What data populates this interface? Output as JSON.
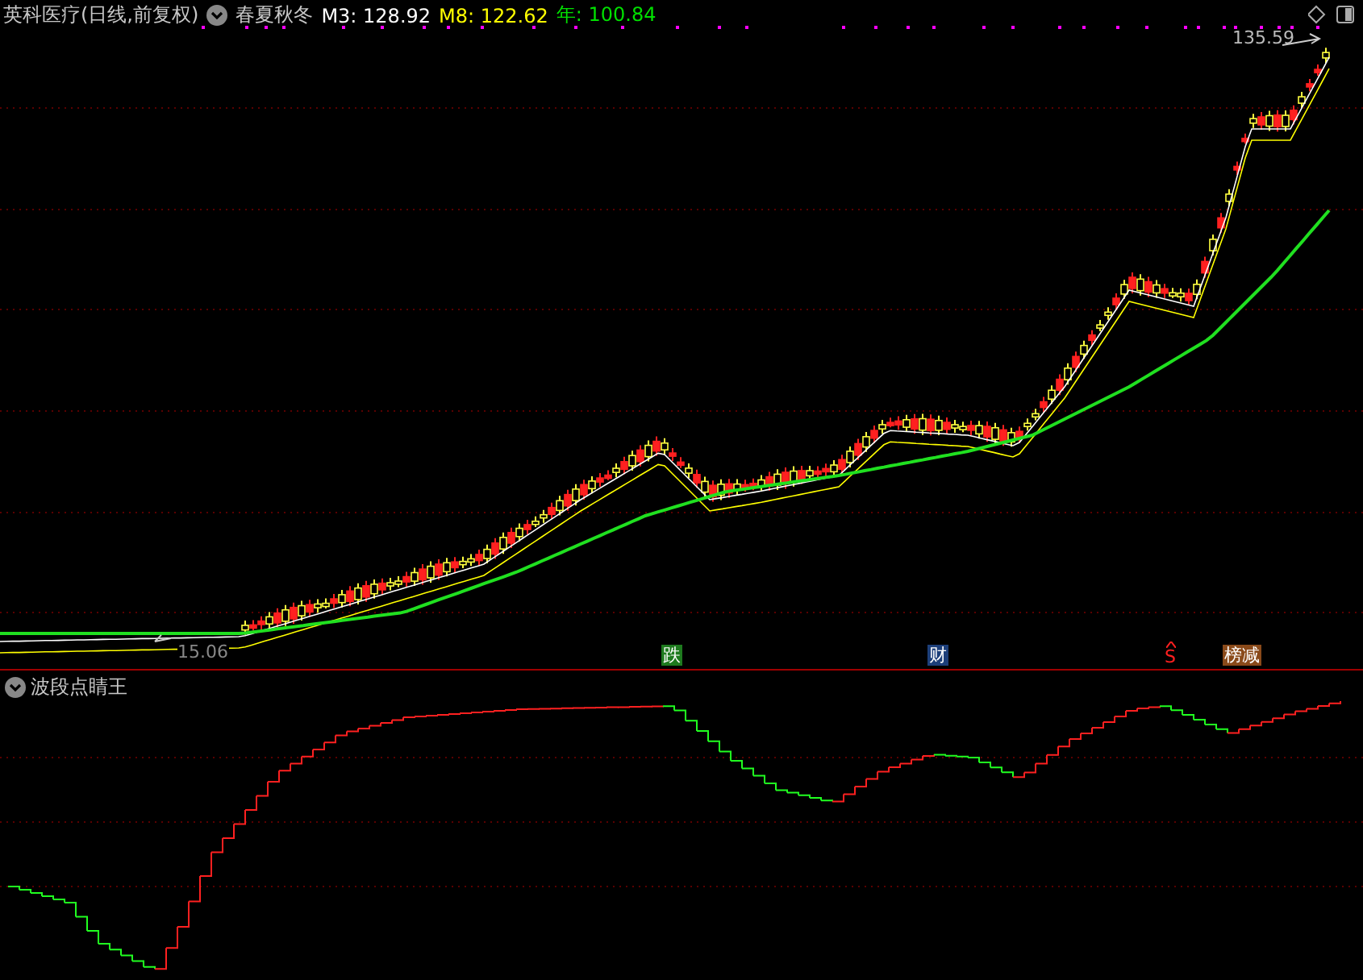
{
  "header": {
    "stock_title": "英科医疗(日线,前复权)",
    "indicator_name": "春夏秋冬",
    "values": [
      {
        "label": "M3:",
        "value": "128.92",
        "color": "#ffffff"
      },
      {
        "label": "M8:",
        "value": "122.62",
        "color": "#ffff00"
      },
      {
        "label": "年:",
        "value": "100.84",
        "color": "#00e000"
      }
    ]
  },
  "price_labels": {
    "high": "135.59",
    "low": "15.06"
  },
  "signals": [
    {
      "kind": "badge",
      "text": "跌",
      "color": "#1e7a1e"
    },
    {
      "kind": "badge",
      "text": "财",
      "color": "#1d3f7a"
    },
    {
      "kind": "mark",
      "text": "S",
      "color": "#ff2020"
    },
    {
      "kind": "badge",
      "text": "榜减",
      "color": "#8a4a1a"
    }
  ],
  "lower_panel": {
    "title": "波段点睛王"
  }
}
